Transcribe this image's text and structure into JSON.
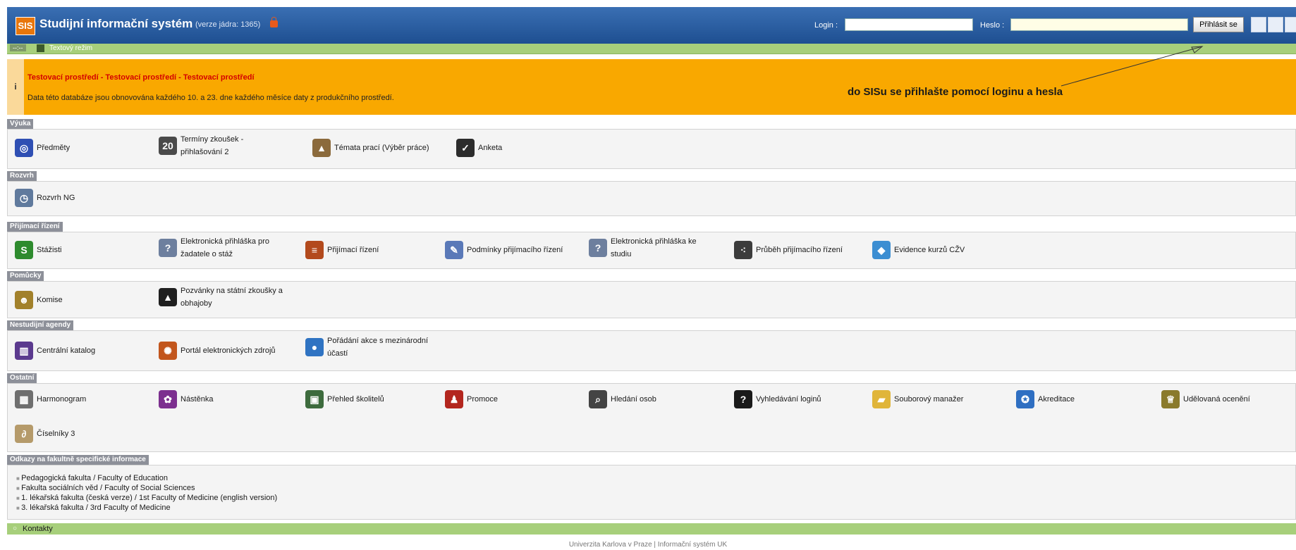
{
  "header": {
    "logo": "SIS",
    "title": "Studijní informační systém",
    "version": "(verze jádra: 1365)",
    "login_label": "Login :",
    "password_label": "Heslo :",
    "login_button": "Přihlásit se"
  },
  "mode_bar": {
    "lang": "--:--",
    "text": "Textový režim"
  },
  "warning": {
    "title": "Testovací prostředí - Testovací prostředí - Testovací prostředí",
    "text": "Data této databáze jsou obnovována každého 10. a 23. dne každého měsíce daty z produkčního prostředí.",
    "note": "do SISu se přihlašte pomocí loginu a hesla",
    "icon": "info-icon"
  },
  "sections": [
    {
      "label": "Výuka",
      "items": [
        {
          "label": "Předměty",
          "icon": "subjects-icon",
          "color": "#2f4fb3",
          "glyph": "◎"
        },
        {
          "label": "Termíny zkoušek - přihlašování 2",
          "icon": "calendar-icon",
          "color": "#4a4a4a",
          "glyph": "20"
        },
        {
          "label": "Témata prací (Výběr práce)",
          "icon": "graduation-cap-icon",
          "color": "#8b6a3c",
          "glyph": "▲"
        },
        {
          "label": "Anketa",
          "icon": "checkbox-icon",
          "color": "#2c2c2c",
          "glyph": "✓"
        }
      ]
    },
    {
      "label": "Rozvrh",
      "items": [
        {
          "label": "Rozvrh NG",
          "icon": "clock-icon",
          "color": "#607a9d",
          "glyph": "◷"
        }
      ]
    },
    {
      "label": "Přijímací řízení",
      "items": [
        {
          "label": "Stážisti",
          "icon": "stazisti-icon",
          "color": "#2e8b2e",
          "glyph": "S"
        },
        {
          "label": "Elektronická přihláška pro žadatele o stáž",
          "icon": "application-document-icon",
          "color": "#6d7f9e",
          "glyph": "?"
        },
        {
          "label": "Přijímací řízení",
          "icon": "admission-documents-icon",
          "color": "#b34a1d",
          "glyph": "≡"
        },
        {
          "label": "Podmínky přijímacího řízení",
          "icon": "conditions-icon",
          "color": "#5a79b8",
          "glyph": "✎"
        },
        {
          "label": "Elektronická přihláška ke studiu",
          "icon": "application-document-icon",
          "color": "#6d7f9e",
          "glyph": "?"
        },
        {
          "label": "Průběh přijímacího řízení",
          "icon": "progress-icon",
          "color": "#3c3c3c",
          "glyph": "⁖"
        },
        {
          "label": "Evidence kurzů CŽV",
          "icon": "course-records-icon",
          "color": "#3c8ed2",
          "glyph": "◆"
        }
      ]
    },
    {
      "label": "Pomůcky",
      "items": [
        {
          "label": "Komise",
          "icon": "committee-icon",
          "color": "#a2812b",
          "glyph": "☻"
        },
        {
          "label": "Pozvánky na státní zkoušky a obhajoby",
          "icon": "mortarboard-icon",
          "color": "#1f1f1f",
          "glyph": "▲"
        }
      ]
    },
    {
      "label": "Nestudijní agendy",
      "items": [
        {
          "label": "Centrální katalog",
          "icon": "books-icon",
          "color": "#5b3a8e",
          "glyph": "▥"
        },
        {
          "label": "Portál elektronických zdrojů",
          "icon": "portal-icon",
          "color": "#c2561d",
          "glyph": "✺"
        },
        {
          "label": "Pořádání akce s mezinárodní účastí",
          "icon": "globe-people-icon",
          "color": "#2f73c2",
          "glyph": "●"
        }
      ]
    },
    {
      "label": "Ostatní",
      "items": [
        {
          "label": "Harmonogram",
          "icon": "schedule-grid-icon",
          "color": "#6f6f6f",
          "glyph": "▦"
        },
        {
          "label": "Nástěnka",
          "icon": "noticeboard-icon",
          "color": "#7c2f8f",
          "glyph": "✿"
        },
        {
          "label": "Přehled školitelů",
          "icon": "supervisors-icon",
          "color": "#3d6b3d",
          "glyph": "▣"
        },
        {
          "label": "Promoce",
          "icon": "graduation-icon",
          "color": "#b3261e",
          "glyph": "♟"
        },
        {
          "label": "Hledání osob",
          "icon": "magnifier-icon",
          "color": "#444444",
          "glyph": "⌕"
        },
        {
          "label": "Vyhledávání loginů",
          "icon": "question-icon",
          "color": "#1a1a1a",
          "glyph": "?"
        },
        {
          "label": "Souborový manažer",
          "icon": "folder-icon",
          "color": "#e0b53a",
          "glyph": "▰"
        },
        {
          "label": "Akreditace",
          "icon": "ribbon-icon",
          "color": "#2f6fc2",
          "glyph": "✪"
        },
        {
          "label": "Udělovaná ocenění",
          "icon": "trophy-icon",
          "color": "#8a7a2c",
          "glyph": "♕"
        },
        {
          "label": "Číselníky 3",
          "icon": "codebook-icon",
          "color": "#b59a6a",
          "glyph": "∂"
        }
      ]
    },
    {
      "label": "Odkazy na fakultně specifické informace",
      "items": []
    }
  ],
  "links": [
    "Pedagogická fakulta / Faculty of Education",
    "Fakulta sociálních věd / Faculty of Social Sciences",
    "1. lékařská fakulta (česká verze) / 1st Faculty of Medicine (english version)",
    "3. lékařská fakulta / 3rd Faculty of Medicine"
  ],
  "contacts": "Kontakty",
  "footer": "Univerzita Karlova v Praze | Informační systém UK"
}
